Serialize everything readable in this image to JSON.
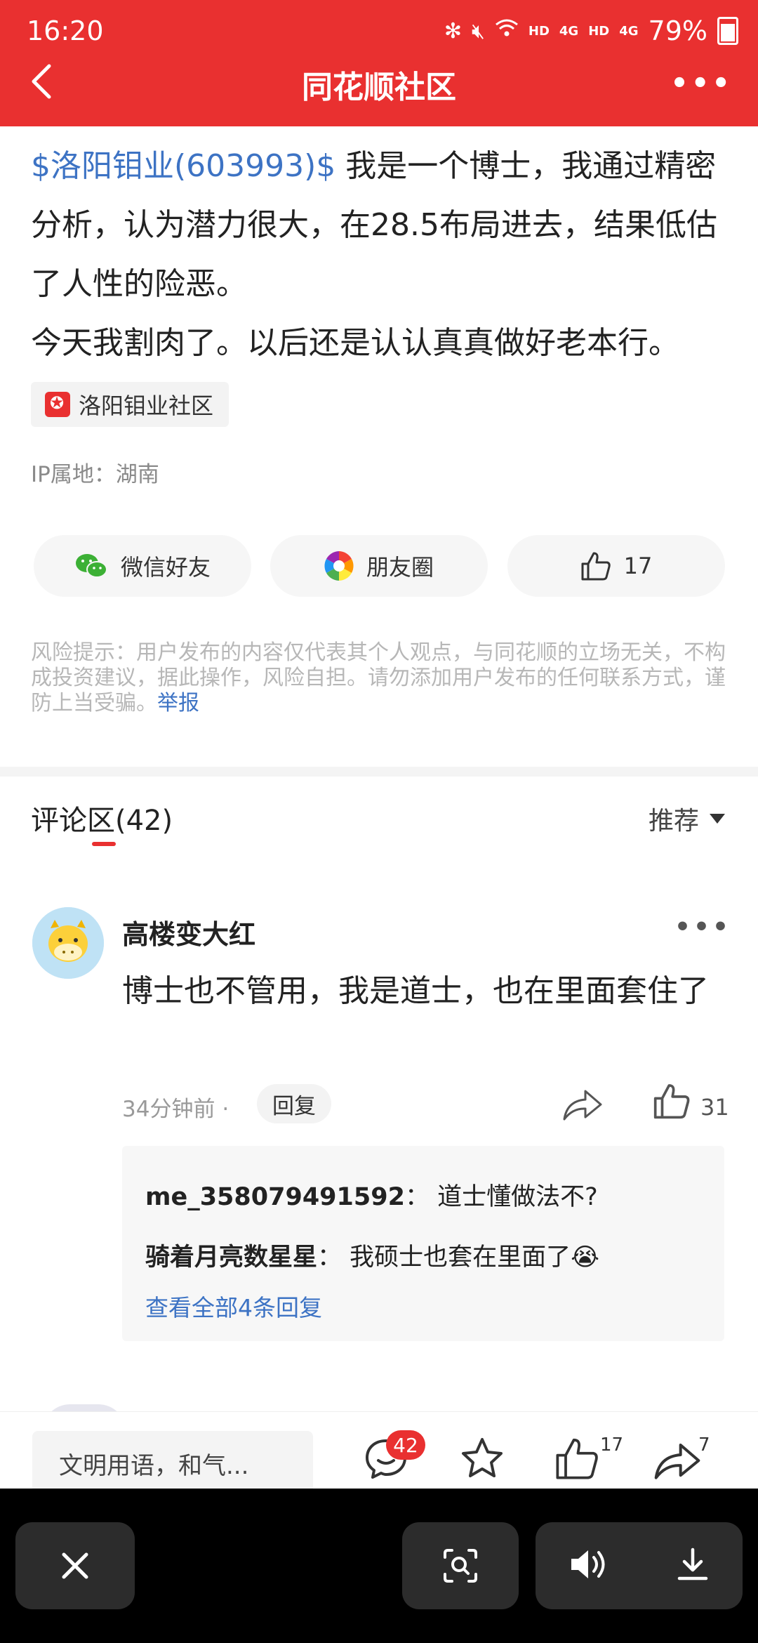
{
  "status_bar": {
    "time": "16:20",
    "network_1": "HD",
    "signal_1": "4G",
    "network_2": "HD",
    "signal_2": "4G",
    "battery": "79%"
  },
  "header": {
    "title": "同花顺社区"
  },
  "post": {
    "stock_tag": "$洛阳钼业(603993)$",
    "body_1": " 我是一个博士，我通过精密分析，认为潜力很大，在28.5布局进去，结果低估了人性的险恶。",
    "body_2": "今天我割肉了。以后还是认认真真做好老本行。",
    "community": "洛阳钼业社区",
    "ip_location": "IP属地：湖南",
    "share_wechat": "微信好友",
    "share_moments": "朋友圈",
    "like_count": "17",
    "risk_note": "风险提示：用户发布的内容仅代表其个人观点，与同花顺的立场无关，不构成投资建议，据此操作，风险自担。请勿添加用户发布的任何联系方式，谨防上当受骗。",
    "report_link": "举报"
  },
  "comments": {
    "title": "评论区(42)",
    "sort_label": "推荐",
    "items": [
      {
        "user": "高楼变大红",
        "text": "博士也不管用，我是道士，也在里面套住了",
        "time": "34分钟前",
        "reply_label": "回复",
        "like_count": "31",
        "replies": [
          {
            "user": "me_358079491592",
            "sep": "：",
            "text": "道士懂做法不?"
          },
          {
            "user": "骑着月亮数星星",
            "sep": "：",
            "text": "我硕士也套在里面了😭"
          }
        ],
        "view_all": "查看全部4条回复"
      }
    ]
  },
  "bottom_bar": {
    "input_placeholder": "文明用语，和气...",
    "comment_count": "42",
    "like_count": "17",
    "share_count": "7"
  },
  "colors": {
    "brand_red": "#e93030",
    "link_blue": "#3d73c4"
  }
}
